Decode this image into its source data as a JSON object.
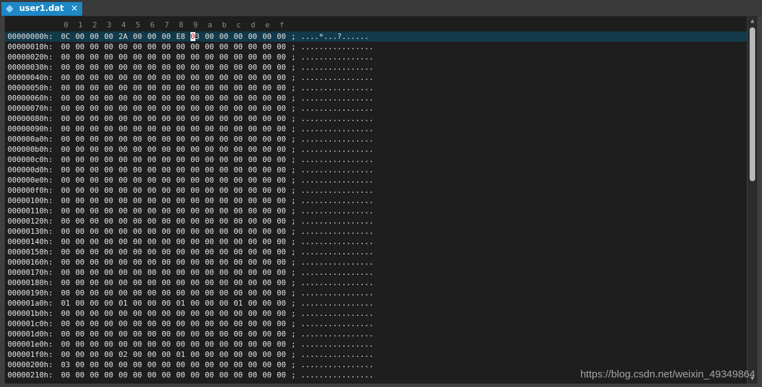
{
  "tab": {
    "title": "user1.dat",
    "close": "×"
  },
  "columns": [
    "0",
    "1",
    "2",
    "3",
    "4",
    "5",
    "6",
    "7",
    "8",
    "9",
    "a",
    "b",
    "c",
    "d",
    "e",
    "f"
  ],
  "separator": ";",
  "rows": [
    {
      "addr": "00000000h:",
      "bytes": [
        "0C",
        "00",
        "00",
        "00",
        "2A",
        "00",
        "00",
        "00",
        "E8",
        "03",
        "00",
        "00",
        "00",
        "00",
        "00",
        "00"
      ],
      "ascii": "....*...?......"
    },
    {
      "addr": "00000010h:",
      "bytes": [
        "00",
        "00",
        "00",
        "00",
        "00",
        "00",
        "00",
        "00",
        "00",
        "00",
        "00",
        "00",
        "00",
        "00",
        "00",
        "00"
      ],
      "ascii": "................"
    },
    {
      "addr": "00000020h:",
      "bytes": [
        "00",
        "00",
        "00",
        "00",
        "00",
        "00",
        "00",
        "00",
        "00",
        "00",
        "00",
        "00",
        "00",
        "00",
        "00",
        "00"
      ],
      "ascii": "................"
    },
    {
      "addr": "00000030h:",
      "bytes": [
        "00",
        "00",
        "00",
        "00",
        "00",
        "00",
        "00",
        "00",
        "00",
        "00",
        "00",
        "00",
        "00",
        "00",
        "00",
        "00"
      ],
      "ascii": "................"
    },
    {
      "addr": "00000040h:",
      "bytes": [
        "00",
        "00",
        "00",
        "00",
        "00",
        "00",
        "00",
        "00",
        "00",
        "00",
        "00",
        "00",
        "00",
        "00",
        "00",
        "00"
      ],
      "ascii": "................"
    },
    {
      "addr": "00000050h:",
      "bytes": [
        "00",
        "00",
        "00",
        "00",
        "00",
        "00",
        "00",
        "00",
        "00",
        "00",
        "00",
        "00",
        "00",
        "00",
        "00",
        "00"
      ],
      "ascii": "................"
    },
    {
      "addr": "00000060h:",
      "bytes": [
        "00",
        "00",
        "00",
        "00",
        "00",
        "00",
        "00",
        "00",
        "00",
        "00",
        "00",
        "00",
        "00",
        "00",
        "00",
        "00"
      ],
      "ascii": "................"
    },
    {
      "addr": "00000070h:",
      "bytes": [
        "00",
        "00",
        "00",
        "00",
        "00",
        "00",
        "00",
        "00",
        "00",
        "00",
        "00",
        "00",
        "00",
        "00",
        "00",
        "00"
      ],
      "ascii": "................"
    },
    {
      "addr": "00000080h:",
      "bytes": [
        "00",
        "00",
        "00",
        "00",
        "00",
        "00",
        "00",
        "00",
        "00",
        "00",
        "00",
        "00",
        "00",
        "00",
        "00",
        "00"
      ],
      "ascii": "................"
    },
    {
      "addr": "00000090h:",
      "bytes": [
        "00",
        "00",
        "00",
        "00",
        "00",
        "00",
        "00",
        "00",
        "00",
        "00",
        "00",
        "00",
        "00",
        "00",
        "00",
        "00"
      ],
      "ascii": "................"
    },
    {
      "addr": "000000a0h:",
      "bytes": [
        "00",
        "00",
        "00",
        "00",
        "00",
        "00",
        "00",
        "00",
        "00",
        "00",
        "00",
        "00",
        "00",
        "00",
        "00",
        "00"
      ],
      "ascii": "................"
    },
    {
      "addr": "000000b0h:",
      "bytes": [
        "00",
        "00",
        "00",
        "00",
        "00",
        "00",
        "00",
        "00",
        "00",
        "00",
        "00",
        "00",
        "00",
        "00",
        "00",
        "00"
      ],
      "ascii": "................"
    },
    {
      "addr": "000000c0h:",
      "bytes": [
        "00",
        "00",
        "00",
        "00",
        "00",
        "00",
        "00",
        "00",
        "00",
        "00",
        "00",
        "00",
        "00",
        "00",
        "00",
        "00"
      ],
      "ascii": "................"
    },
    {
      "addr": "000000d0h:",
      "bytes": [
        "00",
        "00",
        "00",
        "00",
        "00",
        "00",
        "00",
        "00",
        "00",
        "00",
        "00",
        "00",
        "00",
        "00",
        "00",
        "00"
      ],
      "ascii": "................"
    },
    {
      "addr": "000000e0h:",
      "bytes": [
        "00",
        "00",
        "00",
        "00",
        "00",
        "00",
        "00",
        "00",
        "00",
        "00",
        "00",
        "00",
        "00",
        "00",
        "00",
        "00"
      ],
      "ascii": "................"
    },
    {
      "addr": "000000f0h:",
      "bytes": [
        "00",
        "00",
        "00",
        "00",
        "00",
        "00",
        "00",
        "00",
        "00",
        "00",
        "00",
        "00",
        "00",
        "00",
        "00",
        "00"
      ],
      "ascii": "................"
    },
    {
      "addr": "00000100h:",
      "bytes": [
        "00",
        "00",
        "00",
        "00",
        "00",
        "00",
        "00",
        "00",
        "00",
        "00",
        "00",
        "00",
        "00",
        "00",
        "00",
        "00"
      ],
      "ascii": "................"
    },
    {
      "addr": "00000110h:",
      "bytes": [
        "00",
        "00",
        "00",
        "00",
        "00",
        "00",
        "00",
        "00",
        "00",
        "00",
        "00",
        "00",
        "00",
        "00",
        "00",
        "00"
      ],
      "ascii": "................"
    },
    {
      "addr": "00000120h:",
      "bytes": [
        "00",
        "00",
        "00",
        "00",
        "00",
        "00",
        "00",
        "00",
        "00",
        "00",
        "00",
        "00",
        "00",
        "00",
        "00",
        "00"
      ],
      "ascii": "................"
    },
    {
      "addr": "00000130h:",
      "bytes": [
        "00",
        "00",
        "00",
        "00",
        "00",
        "00",
        "00",
        "00",
        "00",
        "00",
        "00",
        "00",
        "00",
        "00",
        "00",
        "00"
      ],
      "ascii": "................"
    },
    {
      "addr": "00000140h:",
      "bytes": [
        "00",
        "00",
        "00",
        "00",
        "00",
        "00",
        "00",
        "00",
        "00",
        "00",
        "00",
        "00",
        "00",
        "00",
        "00",
        "00"
      ],
      "ascii": "................"
    },
    {
      "addr": "00000150h:",
      "bytes": [
        "00",
        "00",
        "00",
        "00",
        "00",
        "00",
        "00",
        "00",
        "00",
        "00",
        "00",
        "00",
        "00",
        "00",
        "00",
        "00"
      ],
      "ascii": "................"
    },
    {
      "addr": "00000160h:",
      "bytes": [
        "00",
        "00",
        "00",
        "00",
        "00",
        "00",
        "00",
        "00",
        "00",
        "00",
        "00",
        "00",
        "00",
        "00",
        "00",
        "00"
      ],
      "ascii": "................"
    },
    {
      "addr": "00000170h:",
      "bytes": [
        "00",
        "00",
        "00",
        "00",
        "00",
        "00",
        "00",
        "00",
        "00",
        "00",
        "00",
        "00",
        "00",
        "00",
        "00",
        "00"
      ],
      "ascii": "................"
    },
    {
      "addr": "00000180h:",
      "bytes": [
        "00",
        "00",
        "00",
        "00",
        "00",
        "00",
        "00",
        "00",
        "00",
        "00",
        "00",
        "00",
        "00",
        "00",
        "00",
        "00"
      ],
      "ascii": "................"
    },
    {
      "addr": "00000190h:",
      "bytes": [
        "00",
        "00",
        "00",
        "00",
        "00",
        "00",
        "00",
        "00",
        "00",
        "00",
        "00",
        "00",
        "00",
        "00",
        "00",
        "00"
      ],
      "ascii": "................"
    },
    {
      "addr": "000001a0h:",
      "bytes": [
        "01",
        "00",
        "00",
        "00",
        "01",
        "00",
        "00",
        "00",
        "01",
        "00",
        "00",
        "00",
        "01",
        "00",
        "00",
        "00"
      ],
      "ascii": "................"
    },
    {
      "addr": "000001b0h:",
      "bytes": [
        "00",
        "00",
        "00",
        "00",
        "00",
        "00",
        "00",
        "00",
        "00",
        "00",
        "00",
        "00",
        "00",
        "00",
        "00",
        "00"
      ],
      "ascii": "................"
    },
    {
      "addr": "000001c0h:",
      "bytes": [
        "00",
        "00",
        "00",
        "00",
        "00",
        "00",
        "00",
        "00",
        "00",
        "00",
        "00",
        "00",
        "00",
        "00",
        "00",
        "00"
      ],
      "ascii": "................"
    },
    {
      "addr": "000001d0h:",
      "bytes": [
        "00",
        "00",
        "00",
        "00",
        "00",
        "00",
        "00",
        "00",
        "00",
        "00",
        "00",
        "00",
        "00",
        "00",
        "00",
        "00"
      ],
      "ascii": "................"
    },
    {
      "addr": "000001e0h:",
      "bytes": [
        "00",
        "00",
        "00",
        "00",
        "00",
        "00",
        "00",
        "00",
        "00",
        "00",
        "00",
        "00",
        "00",
        "00",
        "00",
        "00"
      ],
      "ascii": "................"
    },
    {
      "addr": "000001f0h:",
      "bytes": [
        "00",
        "00",
        "00",
        "00",
        "02",
        "00",
        "00",
        "00",
        "01",
        "00",
        "00",
        "00",
        "00",
        "00",
        "00",
        "00"
      ],
      "ascii": "................"
    },
    {
      "addr": "00000200h:",
      "bytes": [
        "03",
        "00",
        "00",
        "00",
        "00",
        "00",
        "00",
        "00",
        "00",
        "00",
        "00",
        "00",
        "00",
        "00",
        "00",
        "00"
      ],
      "ascii": "................"
    },
    {
      "addr": "00000210h:",
      "bytes": [
        "00",
        "00",
        "00",
        "00",
        "00",
        "00",
        "00",
        "00",
        "00",
        "00",
        "00",
        "00",
        "00",
        "00",
        "00",
        "00"
      ],
      "ascii": "................"
    }
  ],
  "watermark": "https://blog.csdn.net/weixin_49349864",
  "colors": {
    "tab": "#1e88c6",
    "current_row": "#123a4a",
    "cursor": "#ffffff",
    "cursor_text": "#c00000"
  }
}
